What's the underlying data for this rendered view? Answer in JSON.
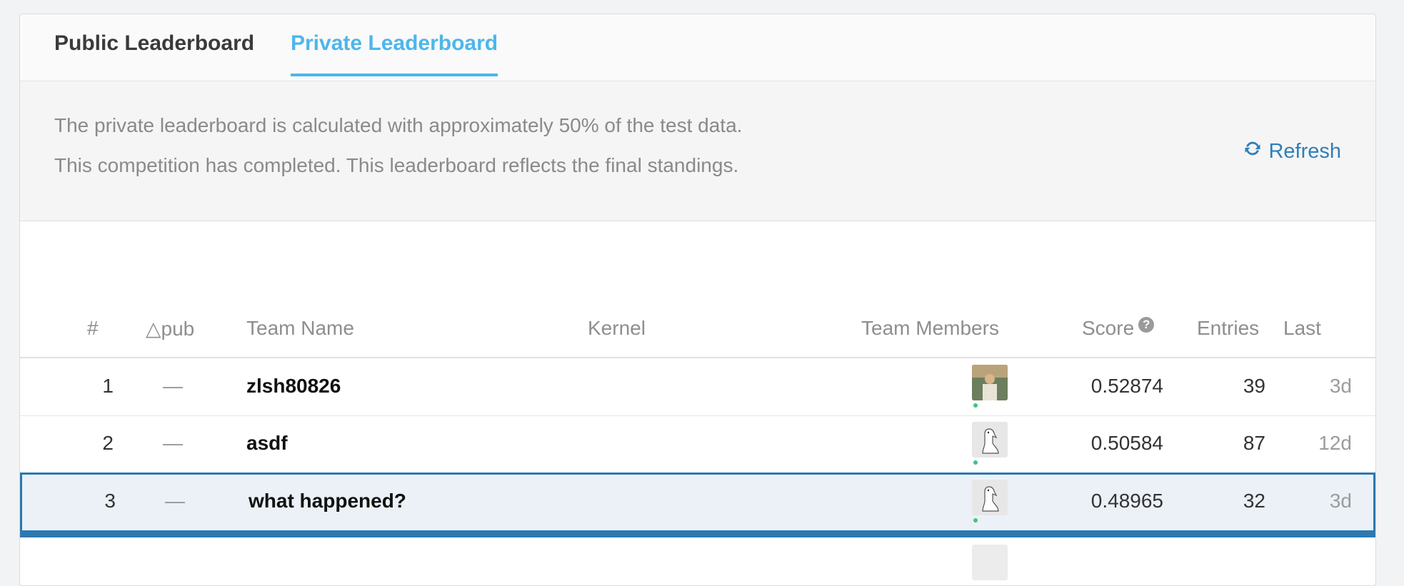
{
  "tabs": [
    {
      "label": "Public Leaderboard",
      "active": false
    },
    {
      "label": "Private Leaderboard",
      "active": true
    }
  ],
  "info": {
    "line1": "The private leaderboard is calculated with approximately 50% of the test data.",
    "line2": "This competition has completed. This leaderboard reflects the final standings.",
    "refresh_label": "Refresh"
  },
  "table": {
    "headers": {
      "rank": "#",
      "delta": "△pub",
      "team": "Team Name",
      "kernel": "Kernel",
      "members": "Team Members",
      "score": "Score",
      "entries": "Entries",
      "last": "Last"
    },
    "rows": [
      {
        "rank": "1",
        "delta": "—",
        "team": "zlsh80826",
        "score": "0.52874",
        "entries": "39",
        "last": "3d",
        "avatar": "photo"
      },
      {
        "rank": "2",
        "delta": "—",
        "team": "asdf",
        "score": "0.50584",
        "entries": "87",
        "last": "12d",
        "avatar": "goose"
      },
      {
        "rank": "3",
        "delta": "—",
        "team": "what happened?",
        "score": "0.48965",
        "entries": "32",
        "last": "3d",
        "avatar": "goose",
        "selected": true
      }
    ]
  },
  "colors": {
    "accent": "#4db6ec",
    "link": "#2e7fb8",
    "selected_border": "#2e78b0",
    "online": "#3cc47c"
  }
}
